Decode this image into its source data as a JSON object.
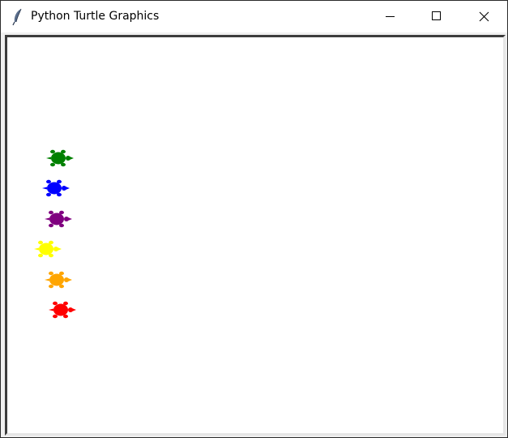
{
  "window": {
    "title": "Python Turtle Graphics",
    "icons": {
      "app": "feather-icon",
      "minimize": "minimize-icon",
      "maximize": "maximize-icon",
      "close": "close-icon"
    }
  },
  "canvas": {
    "background": "#ffffff",
    "turtles": [
      {
        "name": "green-turtle",
        "color": "#008000"
      },
      {
        "name": "blue-turtle",
        "color": "#0000ff"
      },
      {
        "name": "purple-turtle",
        "color": "#800080"
      },
      {
        "name": "yellow-turtle",
        "color": "#ffff00"
      },
      {
        "name": "orange-turtle",
        "color": "#ffa500"
      },
      {
        "name": "red-turtle",
        "color": "#ff0000"
      }
    ]
  }
}
